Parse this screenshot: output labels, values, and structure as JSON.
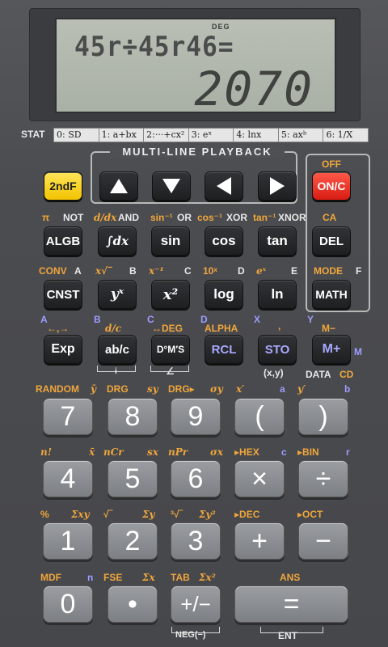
{
  "display": {
    "indicator": "DEG",
    "expression": "45r÷45r46=",
    "result": "2070"
  },
  "stat": {
    "label": "STAT",
    "modes": [
      "0: SD",
      "1: a+bx",
      "2:···+cx²",
      "3: eˣ",
      "4: lnx",
      "5: axᵇ",
      "6: 1/X"
    ]
  },
  "headers": {
    "playback": "MULTI-LINE PLAYBACK",
    "off": "OFF",
    "ca": "CA",
    "mode": "MODE",
    "data": "DATA",
    "ent": "ENT",
    "neg": "NEG(−)"
  },
  "keys": {
    "second": "2ndF",
    "on": "ON/C",
    "algb": "ALGB",
    "integral": "∫dx",
    "sin": "sin",
    "cos": "cos",
    "tan": "tan",
    "del": "DEL",
    "cnst": "CNST",
    "yx": "yˣ",
    "x2": "x²",
    "log": "log",
    "ln": "ln",
    "math": "MATH",
    "exp": "Exp",
    "abc": "ab/c",
    "dms": "D°M′S",
    "rcl": "RCL",
    "sto": "STO",
    "mplus": "M+",
    "n7": "7",
    "n8": "8",
    "n9": "9",
    "lparen": "(",
    "rparen": ")",
    "n4": "4",
    "n5": "5",
    "n6": "6",
    "times": "×",
    "divide": "÷",
    "n1": "1",
    "n2": "2",
    "n3": "3",
    "plus": "+",
    "minus": "−",
    "n0": "0",
    "dot": "•",
    "sign": "+/−",
    "equals": "="
  },
  "labels": {
    "row2": {
      "pi": "π",
      "not": "NOT",
      "ddx": "d/dx",
      "and": "AND",
      "asin": "sin⁻¹",
      "or": "OR",
      "acos": "cos⁻¹",
      "xor": "XOR",
      "atan": "tan⁻¹",
      "xnor": "XNOR"
    },
    "row3": {
      "conv": "CONV",
      "a": "A",
      "xroot": "x√‾",
      "b": "B",
      "xinv": "x⁻¹",
      "c": "C",
      "tenx": "10ˣ",
      "d": "D",
      "ex": "eˣ",
      "e": "E",
      "f": "F"
    },
    "row4": {
      "a": "A",
      "arrows": "←,→",
      "b": "B",
      "dc": "d/c",
      "c": "C",
      "deg": "↔DEG",
      "alpha": "ALPHA",
      "d": "D",
      "comma": ",",
      "x": "X",
      "y": "Y",
      "mminus": "M−",
      "m": "M"
    },
    "row4b": {
      "i": "i",
      "angle": "∠",
      "xy": "(x,y)"
    },
    "row5": {
      "random": "RANDOM",
      "ybar": "ȳ",
      "drg": "DRG",
      "sy": "sy",
      "drgr": "DRG▸",
      "sigy": "σy",
      "xp": "x′",
      "a": "a",
      "yp": "y′",
      "b": "b"
    },
    "row6": {
      "nfact": "n!",
      "xbar": "x̄",
      "ncr": "nCr",
      "sx": "sx",
      "npr": "nPr",
      "sigx": "σx",
      "hex": "▸HEX",
      "c": "c",
      "bin": "▸BIN",
      "r": "r",
      "cd": "CD"
    },
    "row7": {
      "pct": "%",
      "sxy": "Σxy",
      "sqrt": "√‾",
      "sy": "Σy",
      "cbrt": "³√‾",
      "sy2": "Σy²",
      "dec": "▸DEC",
      "oct": "▸OCT"
    },
    "row8": {
      "mdf": "MDF",
      "n": "n",
      "fse": "FSE",
      "sx": "Σx",
      "tab": "TAB",
      "sx2": "Σx²",
      "ans": "ANS"
    }
  },
  "colors": {
    "second_key": "#f2c300",
    "on_key": "#d81c12",
    "orange_label": "#f0a63c",
    "blue_label": "#9c9cff",
    "lcd": "#b0b7ad"
  }
}
